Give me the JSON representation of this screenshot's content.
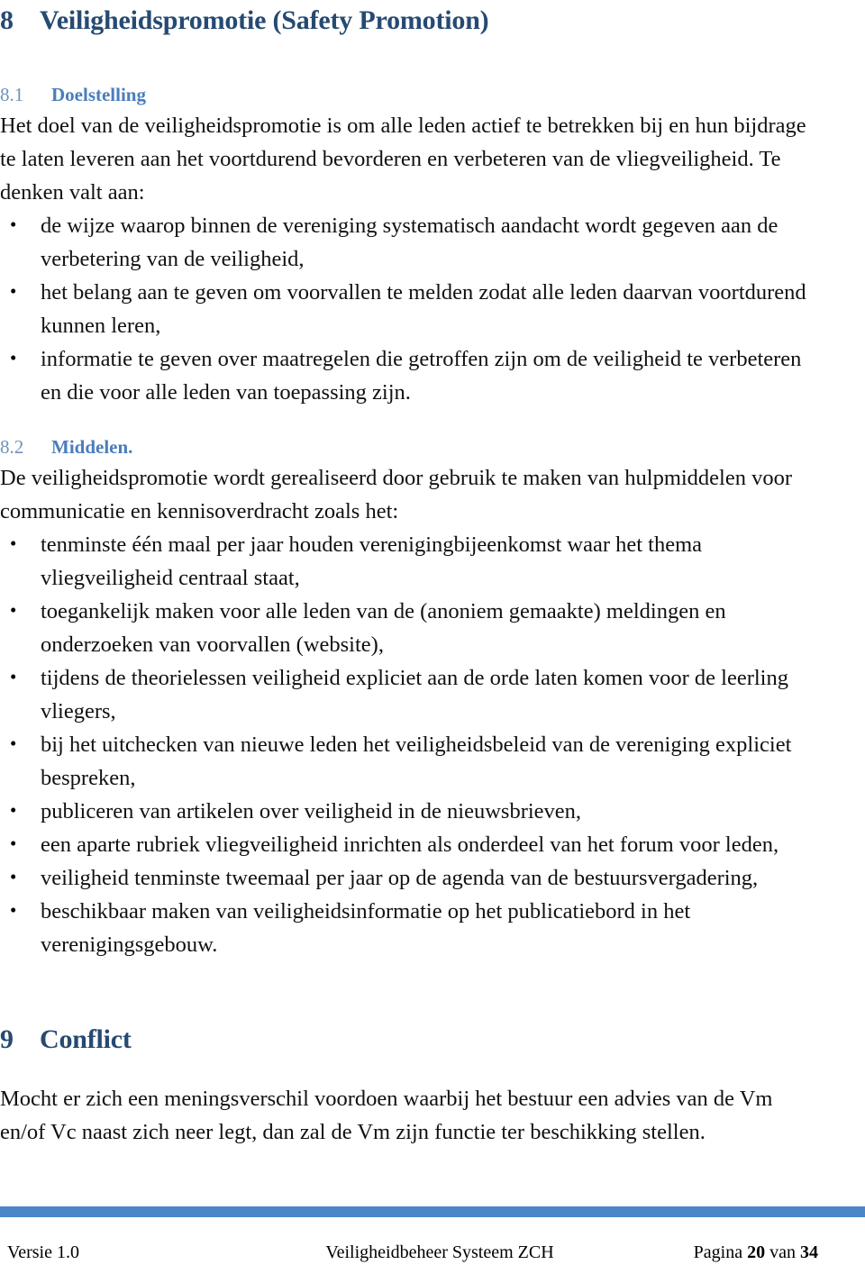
{
  "document": {
    "chapter8": {
      "number": "8",
      "title": "Veiligheidspromotie (Safety Promotion)"
    },
    "section_8_1": {
      "number": "8.1",
      "title": "Doelstelling",
      "paragraph": "Het  doel van de veiligheidspromotie is om alle leden actief te betrekken bij en hun bijdrage te laten leveren aan het voortdurend bevorderen en verbeteren van de vliegveiligheid. Te denken valt aan:",
      "bullets": [
        "de wijze waarop binnen de vereniging systematisch aandacht wordt gegeven aan de verbetering van de veiligheid,",
        "het belang aan te geven om voorvallen te melden zodat alle leden daarvan voortdurend kunnen leren,",
        "informatie te geven over maatregelen die getroffen zijn om de veiligheid te verbeteren en die voor alle leden van toepassing zijn."
      ]
    },
    "section_8_2": {
      "number": "8.2",
      "title": "Middelen.",
      "paragraph": "De veiligheidspromotie wordt gerealiseerd door gebruik te maken van hulpmiddelen voor communicatie en kennisoverdracht zoals het:",
      "bullets": [
        "tenminste één maal per jaar houden verenigingbijeenkomst waar het thema vliegveiligheid centraal staat,",
        "toegankelijk maken voor alle leden van de (anoniem gemaakte) meldingen en onderzoeken van voorvallen (website),",
        "tijdens de theorielessen veiligheid expliciet aan de orde laten komen  voor de leerling vliegers,",
        "bij het uitchecken van nieuwe leden het veiligheidsbeleid van de vereniging expliciet bespreken,",
        "publiceren van artikelen over veiligheid in de nieuwsbrieven,",
        "een aparte rubriek vliegveiligheid inrichten als onderdeel van het forum voor leden,",
        "veiligheid tenminste tweemaal per jaar op de agenda van de bestuursvergadering,",
        "beschikbaar maken van veiligheidsinformatie op het publicatiebord in het verenigingsgebouw."
      ]
    },
    "chapter9": {
      "number": "9",
      "title": "Conflict",
      "paragraph": "Mocht er zich een meningsverschil voordoen waarbij het bestuur een advies van de Vm en/of Vc naast zich neer legt, dan zal de Vm zijn functie ter beschikking stellen."
    }
  },
  "footer": {
    "version": "Versie 1.0",
    "document_title": "Veiligheidbeheer Systeem ZCH",
    "page_label_prefix": "Pagina",
    "page_number": "20",
    "page_label_middle": "van",
    "page_total": "34",
    "rule_color": "#4a86c8"
  },
  "theme": {
    "chapter_heading_color": "#264a72",
    "section_heading_color": "#4a7ebb",
    "body_text_color": "#111111"
  }
}
